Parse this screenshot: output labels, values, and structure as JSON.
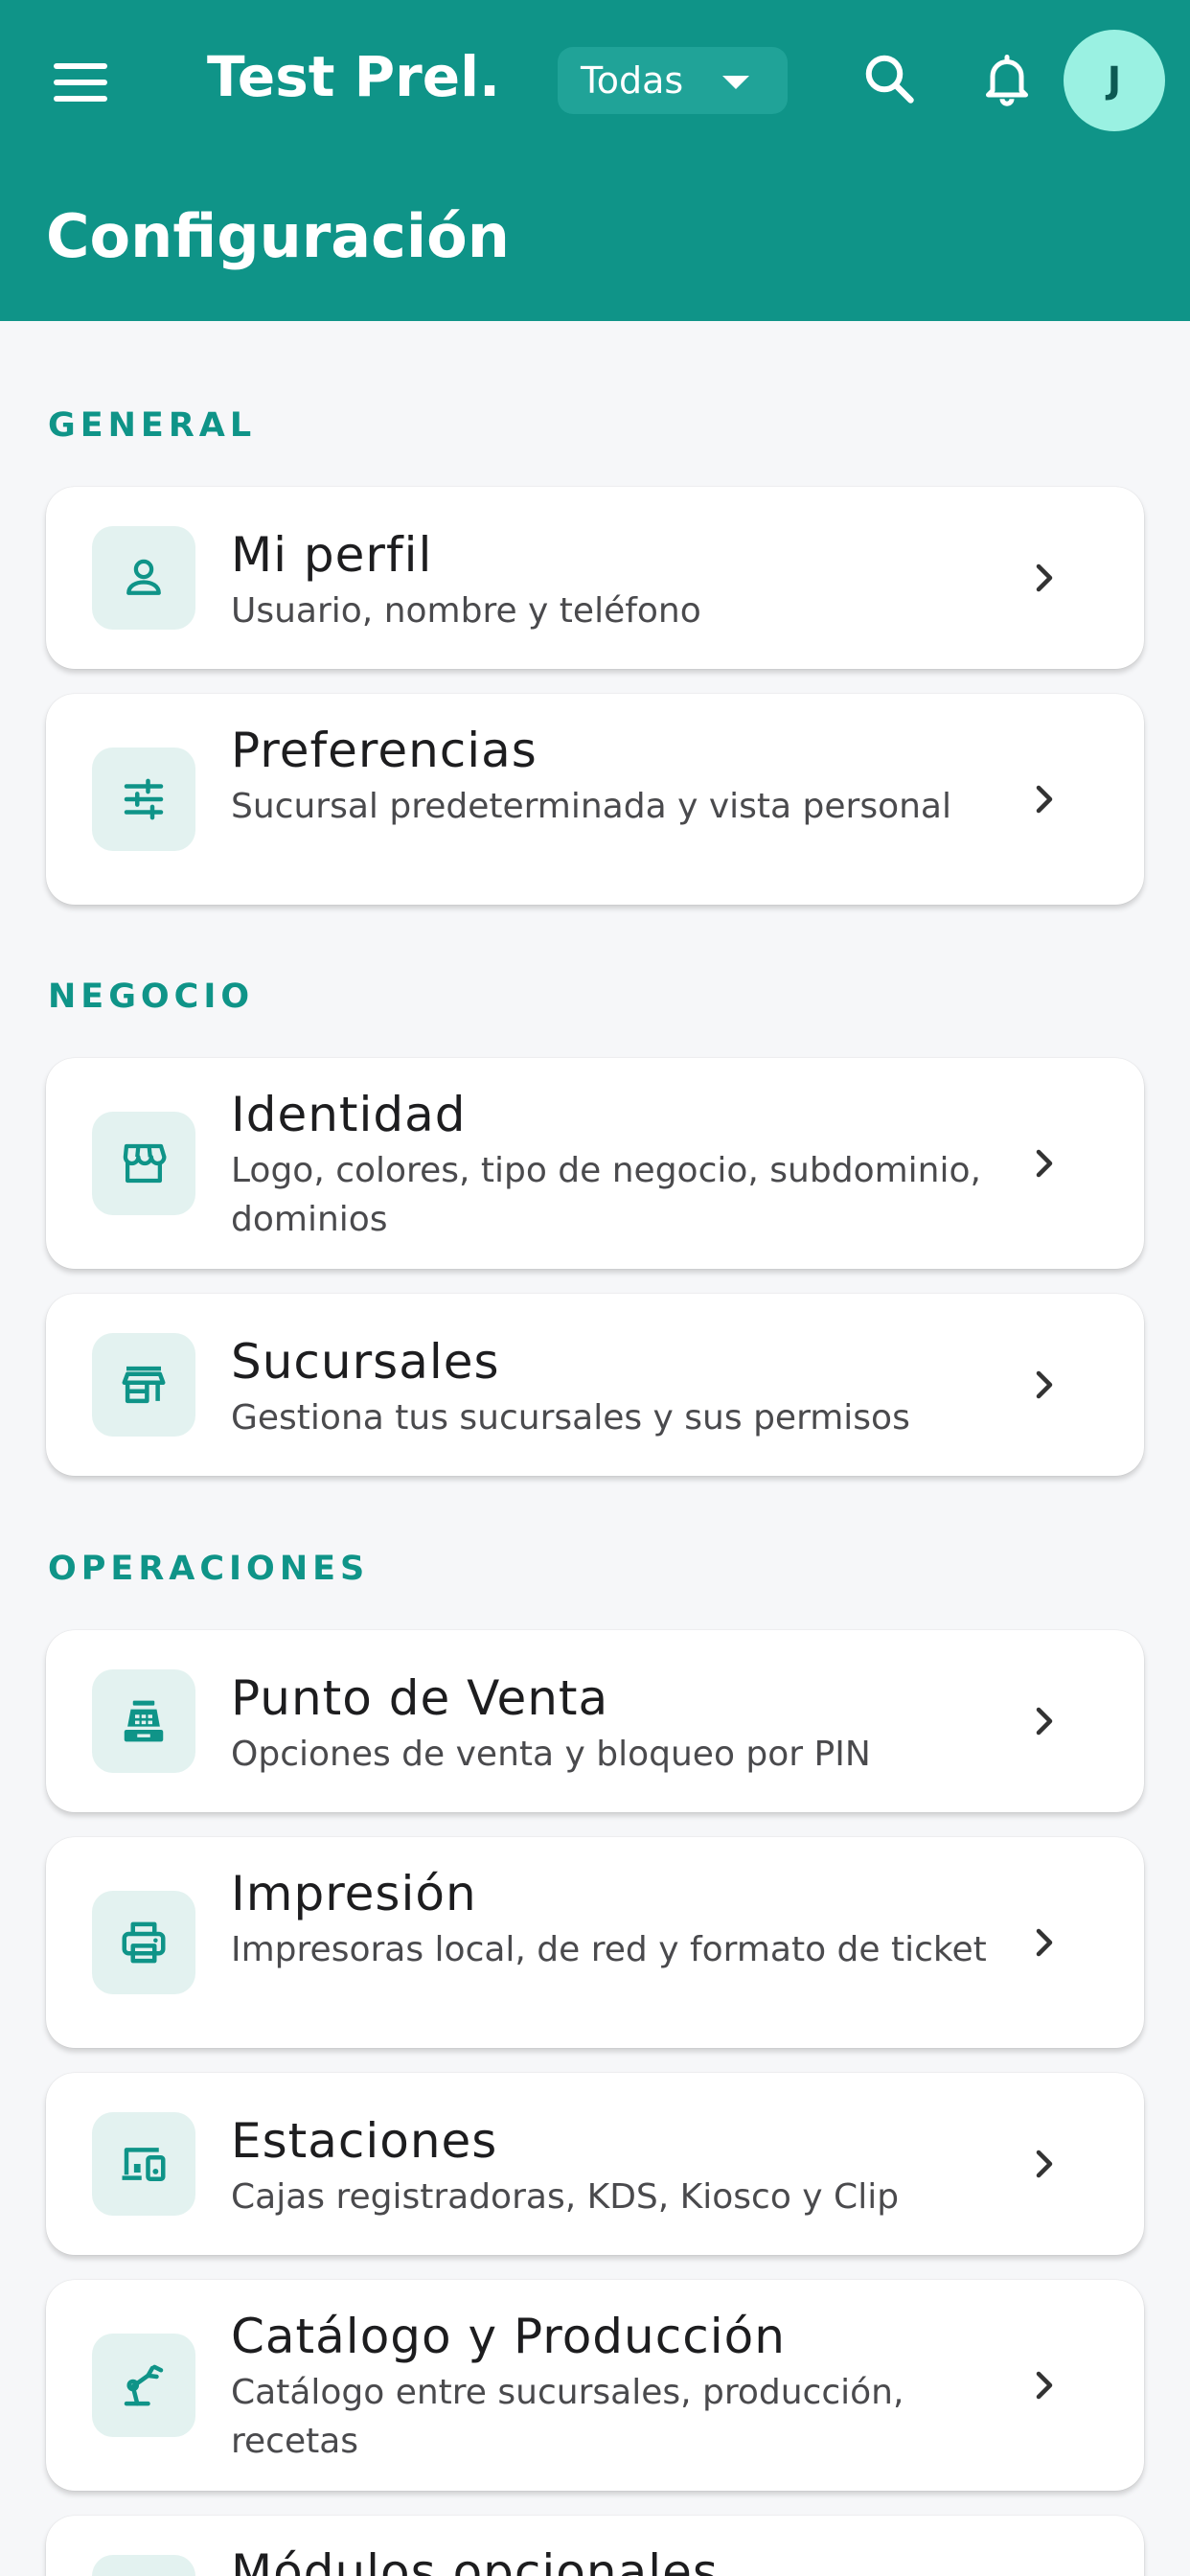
{
  "appbar": {
    "title": "Test Prel...",
    "branch_selector": "Todas",
    "avatar_initial": "J",
    "page_title": "Configuración",
    "background": "#0f9488"
  },
  "sections": {
    "general": "GENERAL",
    "negocio": "NEGOCIO",
    "operaciones": "OPERACIONES"
  },
  "items": [
    {
      "icon": "person-icon",
      "title": "Mi perfil",
      "subtitle": "Usuario, nombre y teléfono"
    },
    {
      "icon": "sliders-icon",
      "title": "Preferencias",
      "subtitle": "Sucursal predeterminada y vista personal"
    },
    {
      "icon": "storefront-icon",
      "title": "Identidad",
      "subtitle": "Logo, colores, tipo de negocio, subdominio, dominios"
    },
    {
      "icon": "store-icon",
      "title": "Sucursales",
      "subtitle": "Gestiona tus sucursales y sus permisos"
    },
    {
      "icon": "cash-register-icon",
      "title": "Punto de Venta",
      "subtitle": "Opciones de venta y bloqueo por PIN"
    },
    {
      "icon": "printer-icon",
      "title": "Impresión",
      "subtitle": "Impresoras local, de red y formato de ticket"
    },
    {
      "icon": "devices-icon",
      "title": "Estaciones",
      "subtitle": "Cajas registradoras, KDS, Kiosco y Clip"
    },
    {
      "icon": "precision-manufacturing-icon",
      "title": "Catálogo y Producción",
      "subtitle": "Catálogo entre sucursales, producción, recetas"
    },
    {
      "icon": "modules-icon",
      "title": "Módulos opcionales",
      "subtitle": ""
    }
  ],
  "colors": {
    "accent": "#0f9488",
    "icon_bg": "#e3f2f0",
    "page_bg": "#f6f7f9"
  }
}
